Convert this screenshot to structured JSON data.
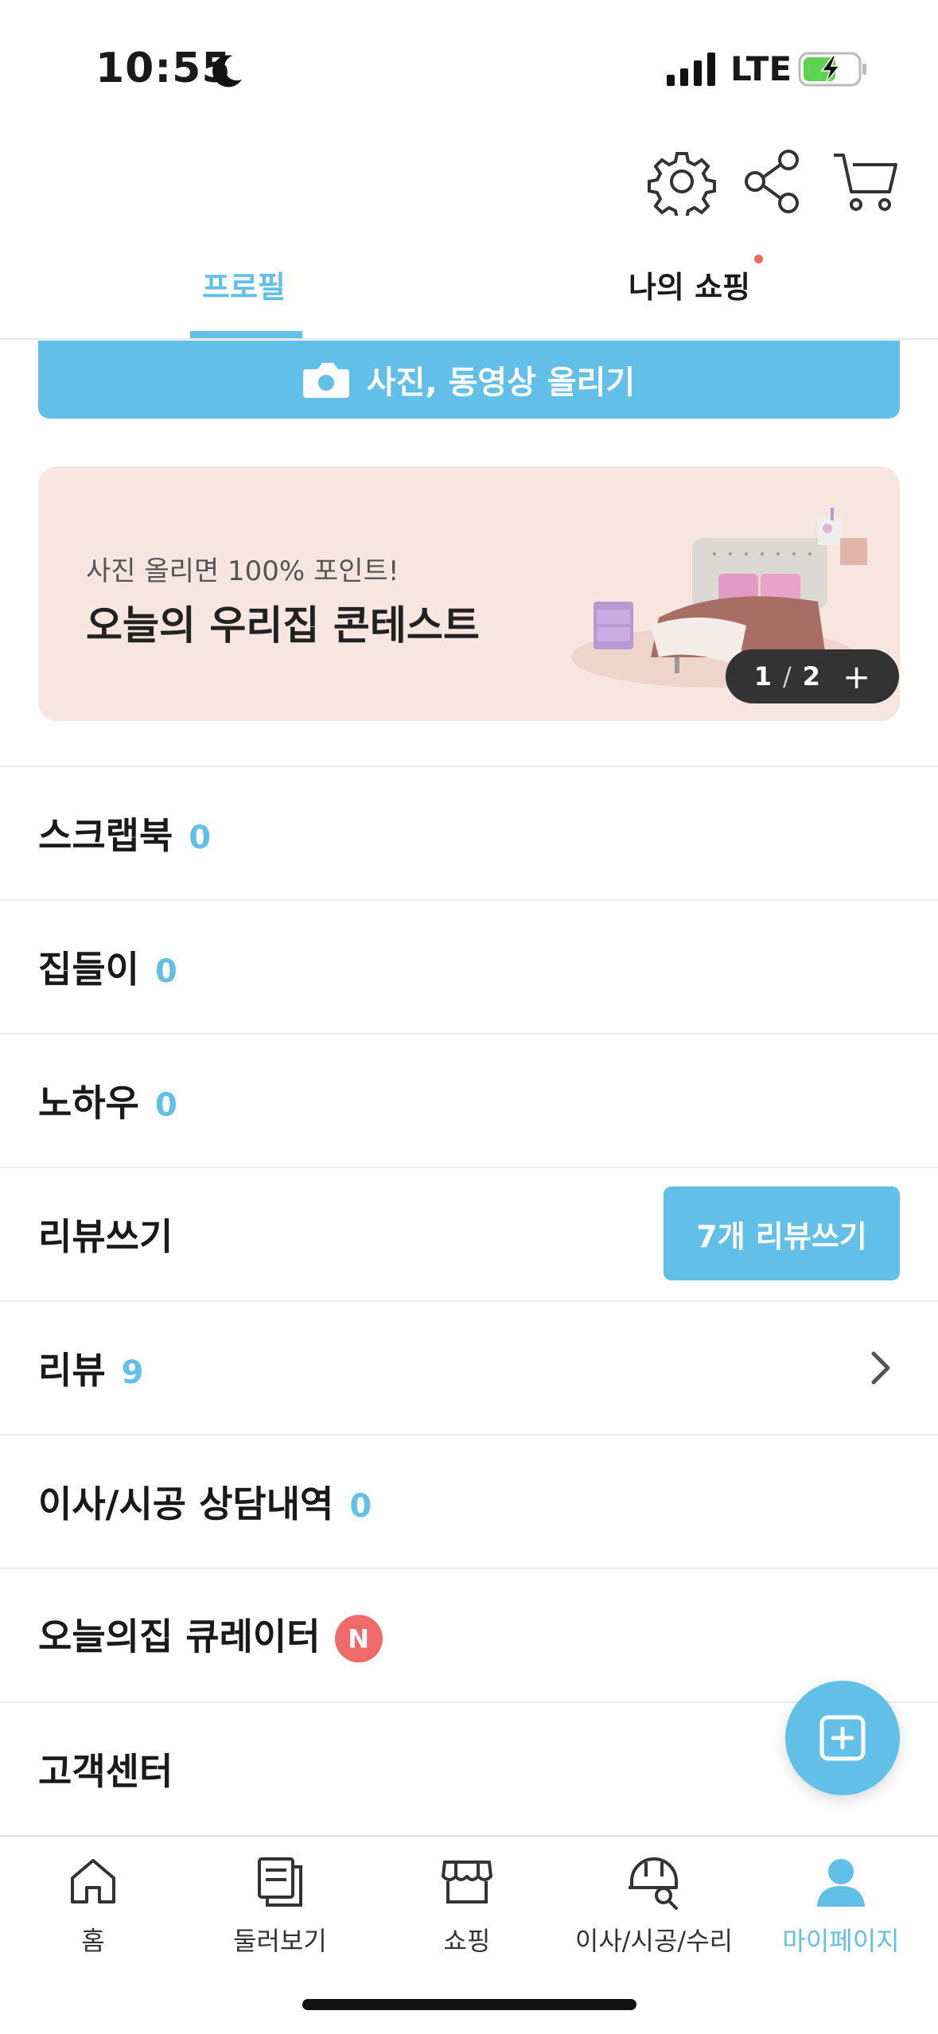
{
  "status_bar": {
    "time": "10:55",
    "network": "LTE"
  },
  "header": {
    "icons": [
      "gear-icon",
      "share-icon",
      "cart-icon"
    ]
  },
  "tabs": [
    {
      "label": "프로필",
      "active": true
    },
    {
      "label": "나의 쇼핑",
      "active": false,
      "has_dot": true
    }
  ],
  "upload": {
    "label": "사진, 동영상 올리기"
  },
  "banner": {
    "subtitle": "사진 올리면 100% 포인트!",
    "title": "오늘의 우리집 콘테스트",
    "page_current": "1",
    "page_separator": "/",
    "page_total": "2",
    "plus": "+"
  },
  "menu": [
    {
      "label": "스크랩북",
      "count": "0"
    },
    {
      "label": "집들이",
      "count": "0"
    },
    {
      "label": "노하우",
      "count": "0"
    },
    {
      "label": "리뷰쓰기",
      "button": "7개 리뷰쓰기"
    },
    {
      "label": "리뷰",
      "count": "9"
    },
    {
      "label": "이사/시공 상담내역",
      "count": "0"
    },
    {
      "label": "오늘의집 큐레이터",
      "badge": "N"
    },
    {
      "label": "고객센터"
    }
  ],
  "bottom_nav": [
    {
      "label": "홈",
      "icon": "home-icon"
    },
    {
      "label": "둘러보기",
      "icon": "browse-icon"
    },
    {
      "label": "쇼핑",
      "icon": "store-icon"
    },
    {
      "label": "이사/시공/수리",
      "icon": "helmet-search-icon"
    },
    {
      "label": "마이페이지",
      "icon": "person-icon",
      "active": true
    }
  ],
  "colors": {
    "accent": "#62c0e8",
    "badge": "#ef6b6b",
    "banner_bg": "#f7e6e0"
  }
}
